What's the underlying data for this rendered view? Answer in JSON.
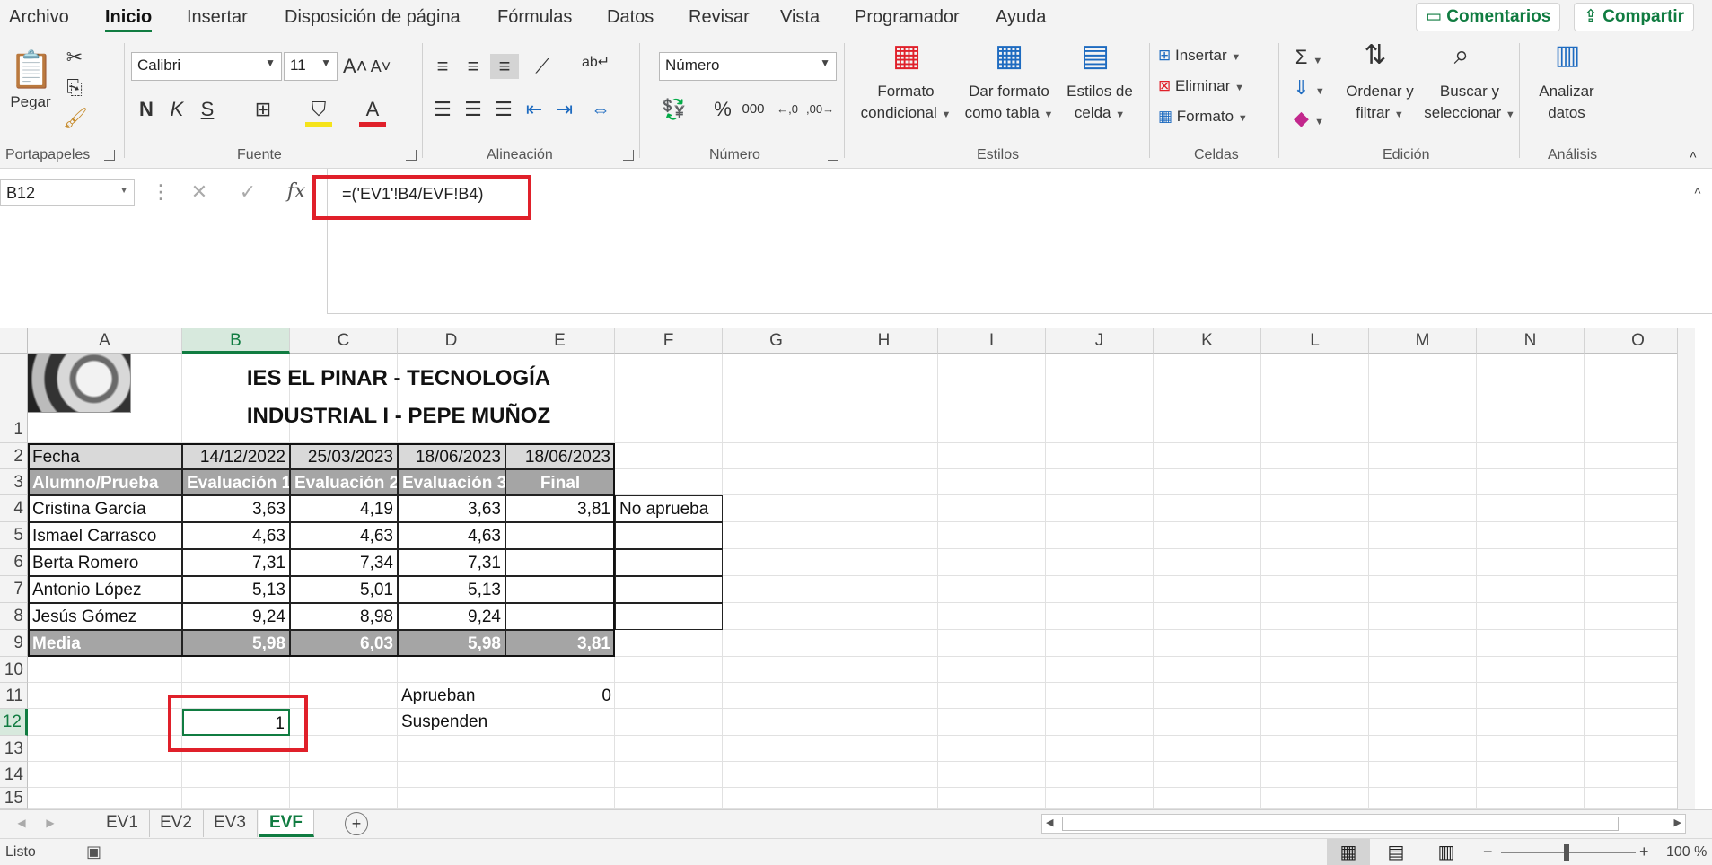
{
  "menu": {
    "tabs": [
      "Archivo",
      "Inicio",
      "Insertar",
      "Disposición de página",
      "Fórmulas",
      "Datos",
      "Revisar",
      "Vista",
      "Programador",
      "Ayuda"
    ],
    "active_tab": "Inicio",
    "comments_label": "Comentarios",
    "share_label": "Compartir"
  },
  "ribbon": {
    "clipboard": {
      "paste_label": "Pegar",
      "group_label": "Portapapeles"
    },
    "font": {
      "font_name": "Calibri",
      "font_size": "11",
      "bold": "N",
      "italic": "K",
      "underline": "S",
      "group_label": "Fuente"
    },
    "alignment": {
      "group_label": "Alineación"
    },
    "number": {
      "format": "Número",
      "percent": "%",
      "thousands": "000",
      "group_label": "Número"
    },
    "styles": {
      "cond_format_1": "Formato",
      "cond_format_2": "condicional",
      "table_format_1": "Dar formato",
      "table_format_2": "como tabla",
      "cell_styles_1": "Estilos de",
      "cell_styles_2": "celda",
      "group_label": "Estilos"
    },
    "cells": {
      "insert": "Insertar",
      "delete": "Eliminar",
      "format": "Formato",
      "group_label": "Celdas"
    },
    "editing": {
      "sort_1": "Ordenar y",
      "sort_2": "filtrar",
      "find_1": "Buscar y",
      "find_2": "seleccionar",
      "group_label": "Edición"
    },
    "analysis": {
      "analyze_1": "Analizar",
      "analyze_2": "datos",
      "group_label": "Análisis"
    }
  },
  "formula_bar": {
    "name_box": "B12",
    "formula": "=('EV1'!B4/EVF!B4)",
    "fx": "fx"
  },
  "columns": [
    "A",
    "B",
    "C",
    "D",
    "E",
    "F",
    "G",
    "H",
    "I",
    "J",
    "K",
    "L",
    "M",
    "N",
    "O"
  ],
  "selected_column": "B",
  "rows": [
    "1",
    "2",
    "3",
    "4",
    "5",
    "6",
    "7",
    "8",
    "9",
    "10",
    "11",
    "12",
    "13",
    "14",
    "15"
  ],
  "selected_row": "12",
  "sheet": {
    "title_line1": "IES EL PINAR - TECNOLOGÍA",
    "title_line2": "INDUSTRIAL I - PEPE MUÑOZ",
    "date_label": "Fecha",
    "dates": [
      "14/12/2022",
      "25/03/2023",
      "18/06/2023",
      "18/06/2023"
    ],
    "header_label": "Alumno/Prueba",
    "headers": [
      "Evaluación 1",
      "Evaluación 2",
      "Evaluación 3",
      "Final"
    ],
    "students": [
      {
        "name": "Cristina García",
        "ev1": "3,63",
        "ev2": "4,19",
        "ev3": "3,63",
        "final": "3,81",
        "result": "No aprueba"
      },
      {
        "name": "Ismael Carrasco",
        "ev1": "4,63",
        "ev2": "4,63",
        "ev3": "4,63",
        "final": "",
        "result": ""
      },
      {
        "name": "Berta Romero",
        "ev1": "7,31",
        "ev2": "7,34",
        "ev3": "7,31",
        "final": "",
        "result": ""
      },
      {
        "name": "Antonio López",
        "ev1": "5,13",
        "ev2": "5,01",
        "ev3": "5,13",
        "final": "",
        "result": ""
      },
      {
        "name": "Jesús Gómez",
        "ev1": "9,24",
        "ev2": "8,98",
        "ev3": "9,24",
        "final": "",
        "result": ""
      }
    ],
    "media_label": "Media",
    "media": [
      "5,98",
      "6,03",
      "5,98",
      "3,81"
    ],
    "approve_label": "Aprueban",
    "approve_value": "0",
    "fail_label": "Suspenden",
    "b12_value": "1"
  },
  "sheet_tabs": [
    "EV1",
    "EV2",
    "EV3",
    "EVF"
  ],
  "active_sheet": "EVF",
  "status": {
    "ready": "Listo",
    "zoom": "100 %"
  }
}
